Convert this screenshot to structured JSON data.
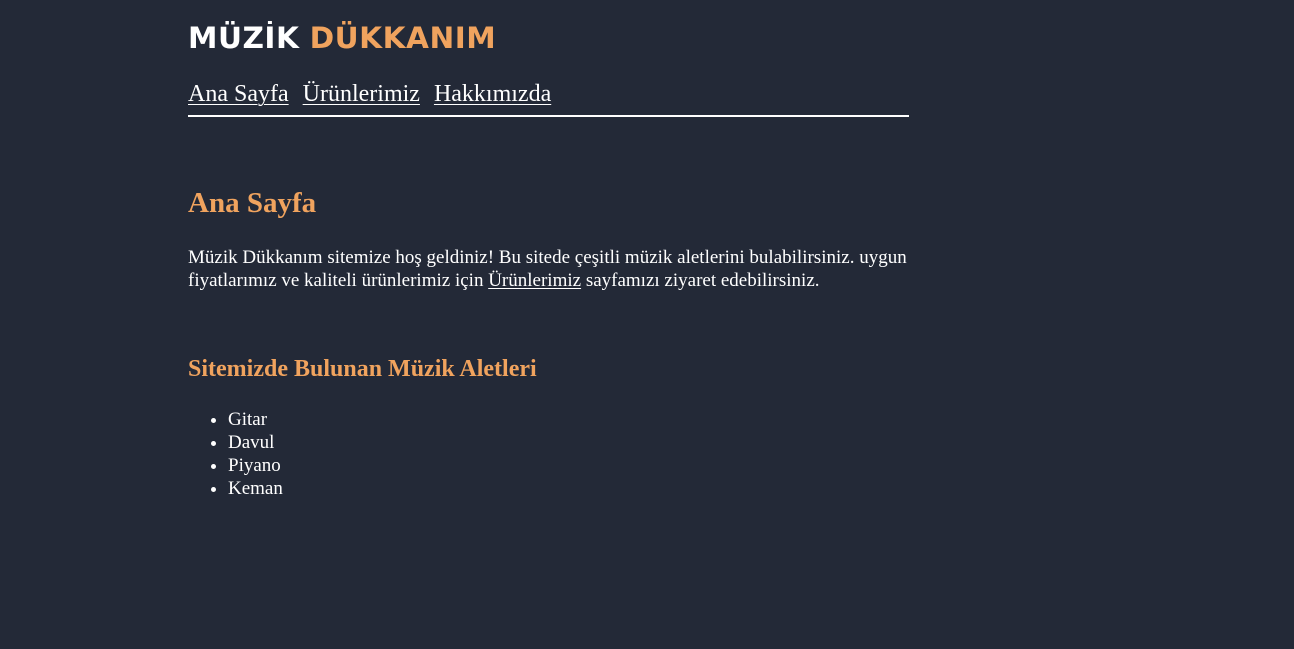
{
  "header": {
    "logo_part1": "MÜZİK",
    "logo_part2": "DÜKKANIM"
  },
  "nav": {
    "items": [
      {
        "label": "Ana Sayfa"
      },
      {
        "label": "Ürünlerimiz"
      },
      {
        "label": "Hakkımızda"
      }
    ]
  },
  "main": {
    "title": "Ana Sayfa",
    "intro_before_link": "Müzik Dükkanım sitemize hoş geldiniz! Bu sitede çeşitli müzik aletlerini bulabilirsiniz. uygun fiyatlarımız ve kaliteli ürünlerimiz için ",
    "intro_link": "Ürünlerimiz",
    "intro_after_link": " sayfamızı ziyaret edebilirsiniz.",
    "section_title": "Sitemizde Bulunan Müzik Aletleri",
    "instruments": [
      "Gitar",
      "Davul",
      "Piyano",
      "Keman"
    ]
  },
  "colors": {
    "background": "#232937",
    "accent": "#f0a35e",
    "text": "#ffffff"
  }
}
